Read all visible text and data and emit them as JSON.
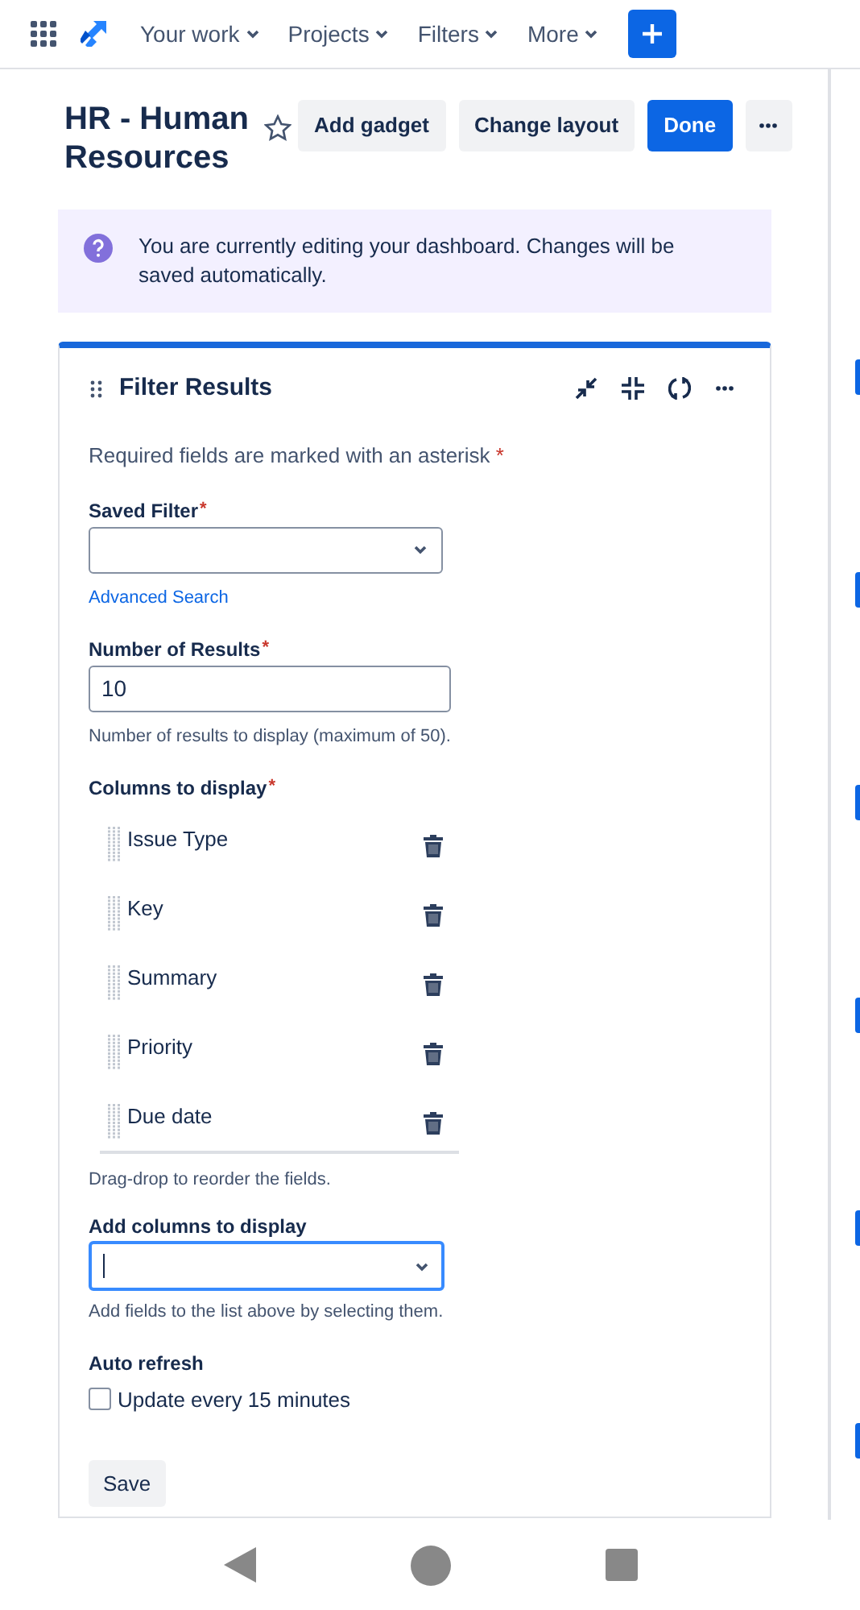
{
  "nav": {
    "items": [
      {
        "label": "Your work"
      },
      {
        "label": "Projects"
      },
      {
        "label": "Filters"
      },
      {
        "label": "More"
      }
    ]
  },
  "dashboard": {
    "title": "HR - Human Resources",
    "starred": false,
    "buttons": [
      {
        "label": "Add gadget",
        "kind": "secondary"
      },
      {
        "label": "Change layout",
        "kind": "secondary"
      },
      {
        "label": "Done",
        "kind": "primary"
      }
    ]
  },
  "banner": {
    "text": "You are currently editing your dashboard. Changes will be saved automatically."
  },
  "gadget": {
    "title": "Filter Results",
    "required_note": "Required fields are marked with an asterisk",
    "required_mark": "*",
    "saved_filter": {
      "label": "Saved Filter",
      "required": true
    },
    "advanced_search": "Advanced Search",
    "number_of_results": {
      "label": "Number of Results",
      "required": true,
      "value": "10",
      "help": "Number of results to display (maximum of 50)."
    },
    "columns": {
      "label": "Columns to display",
      "required": true,
      "items": [
        {
          "label": "Issue Type"
        },
        {
          "label": "Key"
        },
        {
          "label": "Summary"
        },
        {
          "label": "Priority"
        },
        {
          "label": "Due date"
        }
      ],
      "help": "Drag-drop to reorder the fields."
    },
    "add_columns": {
      "label": "Add columns to display",
      "focused": true,
      "help": "Add fields to the list above by selecting them."
    },
    "auto_refresh": {
      "label": "Auto refresh",
      "option": "Update every 15 minutes",
      "checked": false
    },
    "save_button": "Save"
  }
}
